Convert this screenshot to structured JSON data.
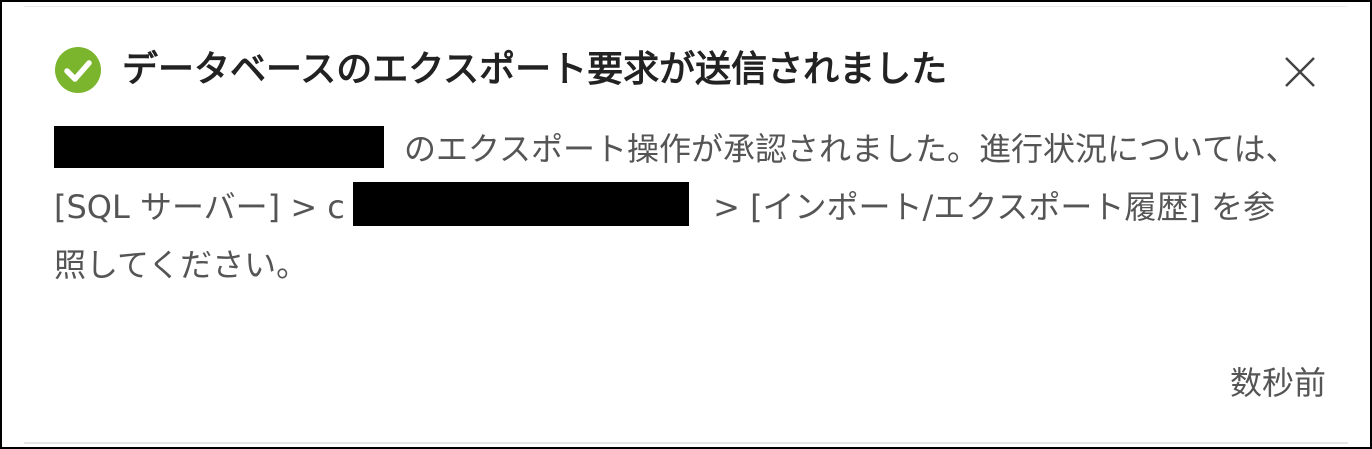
{
  "notification": {
    "title": "データベースのエクスポート要求が送信されました",
    "icons": {
      "status": "check-circle-icon",
      "close": "close-icon"
    },
    "colors": {
      "success": "#7ab52d",
      "title": "#222222",
      "body": "#555555"
    },
    "message": {
      "line1_text": "のエクスポート操作が承認されました。進行状況については、",
      "line2_prefix": "[SQL サーバー] > c",
      "line2_suffix": " > [インポート/エクスポート履歴] を参",
      "line3": "照してください。"
    },
    "timestamp": "数秒前"
  }
}
